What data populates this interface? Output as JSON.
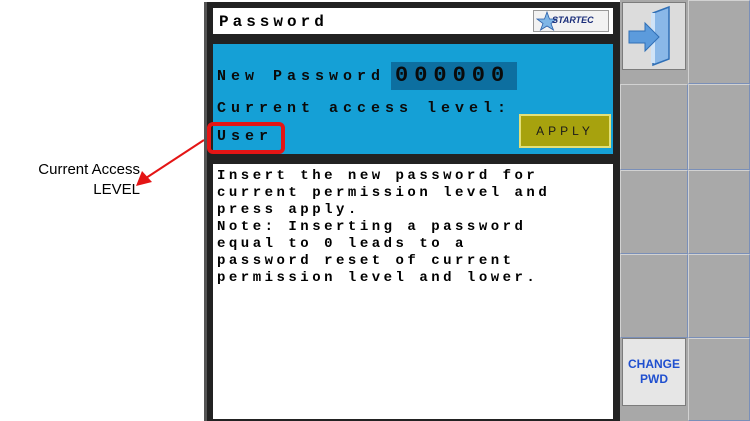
{
  "annotation": {
    "callout_line1": "Current Access",
    "callout_line2": "LEVEL"
  },
  "screen": {
    "title": "Password",
    "logo_text": "STARTEC",
    "new_password_label": "New Password",
    "new_password_value": "000000",
    "access_level_label": "Current access level:",
    "access_level_value": "User",
    "apply_label": "APPLY",
    "info_text": "Insert the new password for\ncurrent permission level and\npress apply.\nNote: Inserting a password\nequal to 0 leads to a\npassword reset of current\npermission level and lower."
  },
  "sidebar": {
    "exit_icon": "exit-door-icon",
    "change_pwd_line1": "CHANGE",
    "change_pwd_line2": "PWD"
  },
  "colors": {
    "panel_blue": "#15a0d6",
    "field_blue": "#0d6fa0",
    "apply_olive": "#a7a20e",
    "highlight_red": "#e41515",
    "button_text_blue": "#1f4fcf"
  }
}
